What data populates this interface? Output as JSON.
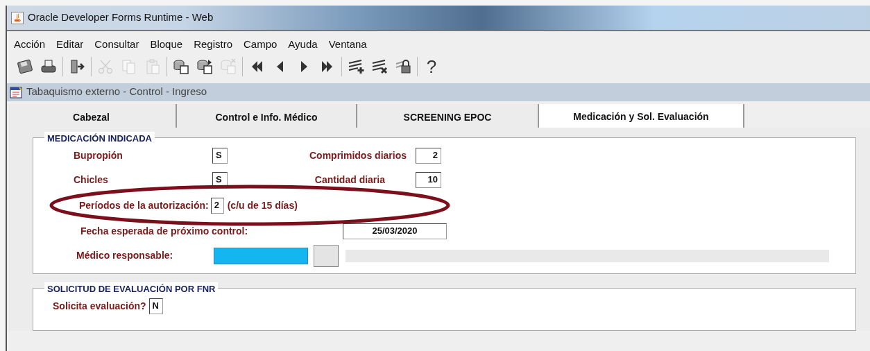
{
  "window": {
    "title": "Oracle Developer Forms Runtime - Web"
  },
  "menu": [
    "Acción",
    "Editar",
    "Consultar",
    "Bloque",
    "Registro",
    "Campo",
    "Ayuda",
    "Ventana"
  ],
  "toolbar": [
    [
      {
        "kind": "save",
        "disabled": false
      },
      {
        "kind": "print",
        "disabled": false
      }
    ],
    [
      {
        "kind": "exit",
        "disabled": false
      }
    ],
    [
      {
        "kind": "cut",
        "disabled": true
      },
      {
        "kind": "copy",
        "disabled": true
      },
      {
        "kind": "paste",
        "disabled": true
      }
    ],
    [
      {
        "kind": "enter-query",
        "disabled": false
      },
      {
        "kind": "execute-query",
        "disabled": false
      },
      {
        "kind": "cancel-query",
        "disabled": true
      }
    ],
    [
      {
        "kind": "first",
        "disabled": false
      },
      {
        "kind": "prev",
        "disabled": false
      },
      {
        "kind": "next",
        "disabled": false
      },
      {
        "kind": "last",
        "disabled": false
      }
    ],
    [
      {
        "kind": "insert",
        "disabled": false
      },
      {
        "kind": "delete",
        "disabled": false
      },
      {
        "kind": "lock",
        "disabled": false
      }
    ],
    [
      {
        "kind": "help",
        "text": "?",
        "disabled": false
      }
    ]
  ],
  "form": {
    "title": "Tabaquismo externo - Control - Ingreso"
  },
  "tabs": [
    {
      "label": "Cabezal",
      "selected": false
    },
    {
      "label": "Control e Info. Médico",
      "selected": false
    },
    {
      "label": "SCREENING EPOC",
      "selected": false
    },
    {
      "label": "Medicación y Sol. Evaluación",
      "selected": true
    }
  ],
  "medicacion": {
    "legend": "MEDICACIÓN INDICADA",
    "bupropion": {
      "label": "Bupropión",
      "value": "S"
    },
    "comprimidos": {
      "label": "Comprimidos diarios",
      "value": "2"
    },
    "chicles": {
      "label": "Chicles",
      "value": "S"
    },
    "cantidad": {
      "label": "Cantidad diaria",
      "value": "10"
    },
    "periodos": {
      "label": "Períodos de la autorización:",
      "value": "2",
      "suffix": "(c/u de 15 días)"
    },
    "fecha": {
      "label": "Fecha esperada de próximo control:",
      "value": "25/03/2020"
    },
    "medico": {
      "label": "Médico responsable:",
      "focused": true
    }
  },
  "solicitud": {
    "legend": "SOLICITUD DE EVALUACIÓN POR FNR",
    "solicita": {
      "label": "Solicita evaluación?",
      "value": "N"
    }
  }
}
